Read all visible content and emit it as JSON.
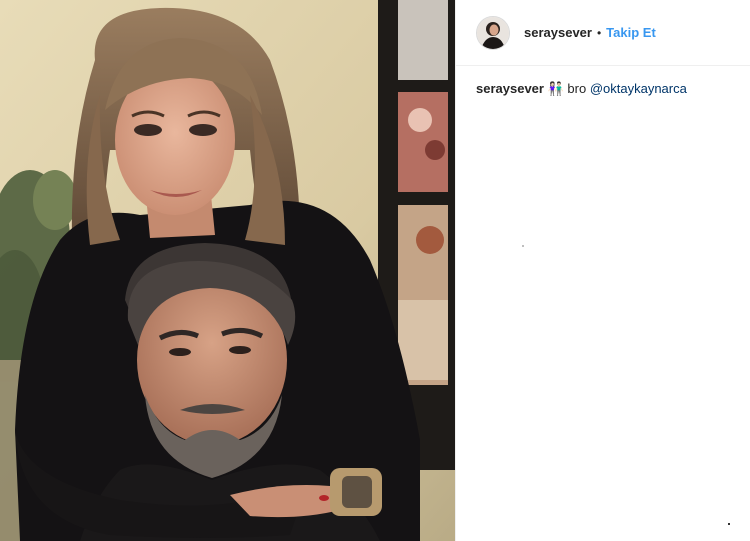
{
  "post": {
    "username": "seraysever",
    "separator": "•",
    "follow_label": "Takip Et",
    "caption": {
      "username": "seraysever",
      "emoji": "👫🏻",
      "text": "bro",
      "mention": "@oktaykaynarca"
    }
  },
  "colors": {
    "accent": "#3897f0",
    "mention": "#003569",
    "border": "#efefef"
  },
  "icons": {
    "avatar": "profile-avatar"
  }
}
